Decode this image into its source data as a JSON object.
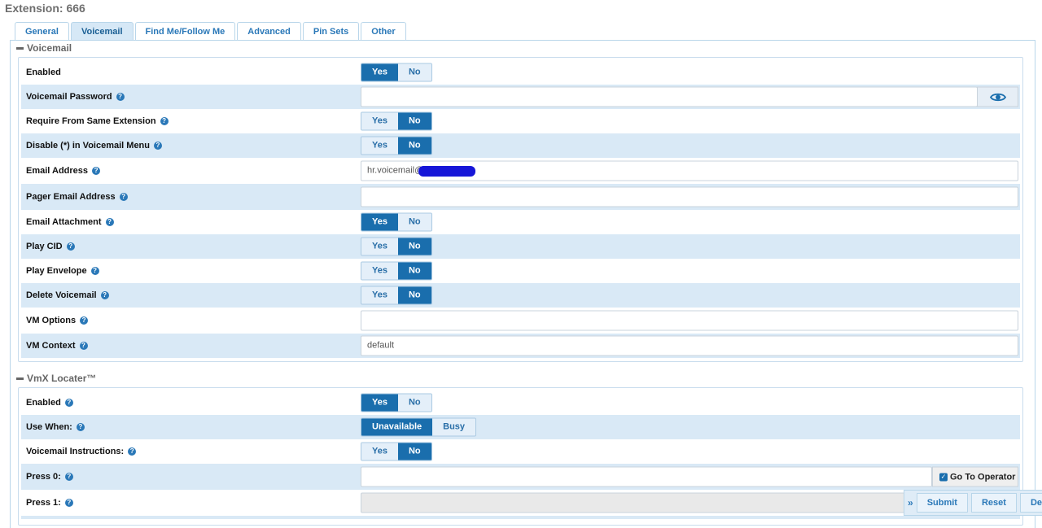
{
  "page_title": "Extension: 666",
  "tabs": [
    {
      "label": "General"
    },
    {
      "label": "Voicemail"
    },
    {
      "label": "Find Me/Follow Me"
    },
    {
      "label": "Advanced"
    },
    {
      "label": "Pin Sets"
    },
    {
      "label": "Other"
    }
  ],
  "active_tab": "Voicemail",
  "voicemail": {
    "section_title": "Voicemail",
    "enabled": {
      "label": "Enabled",
      "yes": "Yes",
      "no": "No",
      "value": "Yes"
    },
    "password": {
      "label": "Voicemail Password",
      "value": ""
    },
    "require_same_ext": {
      "label": "Require From Same Extension",
      "yes": "Yes",
      "no": "No",
      "value": "No"
    },
    "disable_star": {
      "label": "Disable (*) in Voicemail Menu",
      "yes": "Yes",
      "no": "No",
      "value": "No"
    },
    "email_address": {
      "label": "Email Address",
      "value": "hr.voicemail@"
    },
    "pager_email": {
      "label": "Pager Email Address",
      "value": ""
    },
    "email_attachment": {
      "label": "Email Attachment",
      "yes": "Yes",
      "no": "No",
      "value": "Yes"
    },
    "play_cid": {
      "label": "Play CID",
      "yes": "Yes",
      "no": "No",
      "value": "No"
    },
    "play_envelope": {
      "label": "Play Envelope",
      "yes": "Yes",
      "no": "No",
      "value": "No"
    },
    "delete_voicemail": {
      "label": "Delete Voicemail",
      "yes": "Yes",
      "no": "No",
      "value": "No"
    },
    "vm_options": {
      "label": "VM Options",
      "value": ""
    },
    "vm_context": {
      "label": "VM Context",
      "value": "default"
    }
  },
  "vmx": {
    "section_title": "VmX Locater™",
    "enabled": {
      "label": "Enabled",
      "yes": "Yes",
      "no": "No",
      "value": "Yes"
    },
    "use_when": {
      "label": "Use When:",
      "unavailable": "Unavailable",
      "busy": "Busy",
      "value": "Unavailable"
    },
    "instructions": {
      "label": "Voicemail Instructions:",
      "yes": "Yes",
      "no": "No",
      "value": "No"
    },
    "press0": {
      "label": "Press 0:",
      "value": "",
      "addon": "Go To Operator"
    },
    "press1": {
      "label": "Press 1:",
      "value": ""
    }
  },
  "actions": {
    "submit": "Submit",
    "reset": "Reset",
    "delete": "De"
  },
  "icons": {
    "help": "help-icon",
    "eye": "eye-icon",
    "collapse": "minus-icon"
  }
}
